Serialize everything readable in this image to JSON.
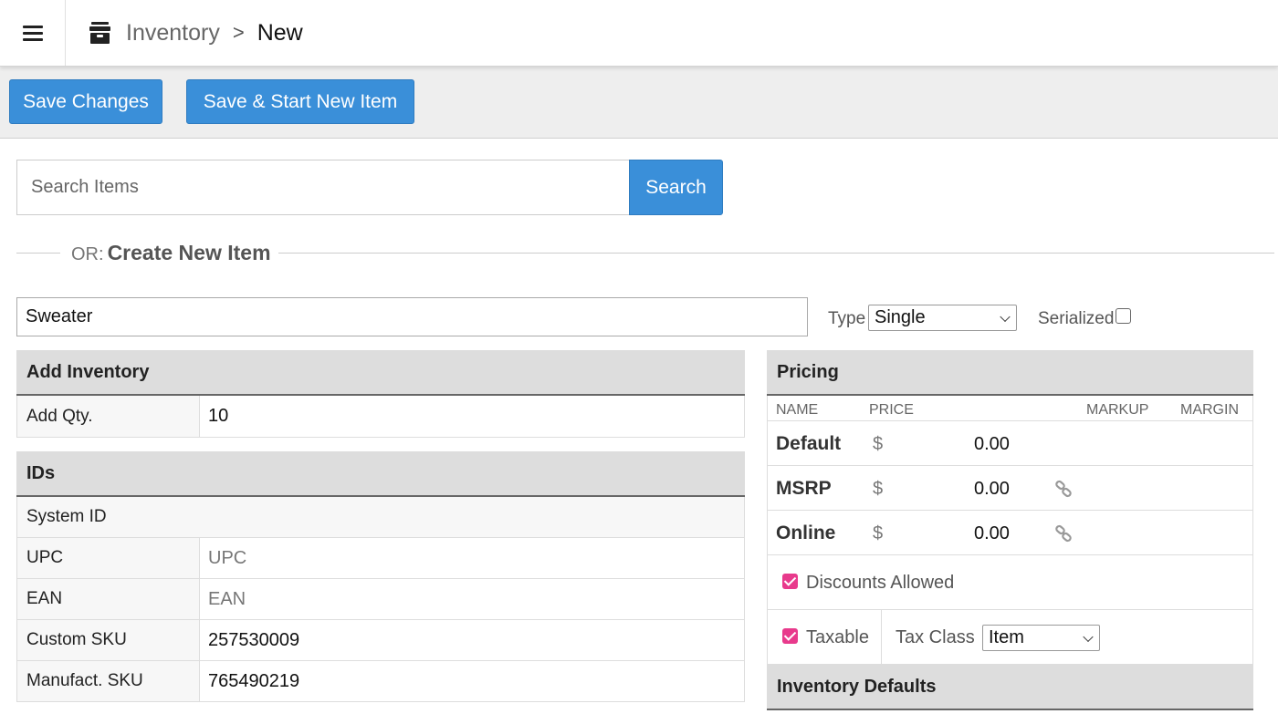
{
  "header": {
    "breadcrumb_parent": "Inventory",
    "breadcrumb_separator": ">",
    "breadcrumb_current": "New"
  },
  "toolbar": {
    "save_label": "Save Changes",
    "save_new_label": "Save & Start New Item"
  },
  "search": {
    "placeholder": "Search Items",
    "value": "",
    "button_label": "Search"
  },
  "create": {
    "or_label": "OR:",
    "title": "Create New Item",
    "item_name": "Sweater",
    "type_label": "Type",
    "type_value": "Single",
    "serialized_label": "Serialized",
    "serialized_checked": false
  },
  "add_inventory": {
    "title": "Add Inventory",
    "qty_label": "Add Qty.",
    "qty_value": "10"
  },
  "ids": {
    "title": "IDs",
    "system_id_label": "System ID",
    "upc_label": "UPC",
    "upc_placeholder": "UPC",
    "ean_label": "EAN",
    "ean_placeholder": "EAN",
    "custom_sku_label": "Custom SKU",
    "custom_sku_value": "257530009",
    "manufact_sku_label": "Manufact. SKU",
    "manufact_sku_value": "765490219"
  },
  "pricing": {
    "title": "Pricing",
    "columns": {
      "name": "NAME",
      "price": "PRICE",
      "markup": "MARKUP",
      "margin": "MARGIN"
    },
    "rows": [
      {
        "name": "Default",
        "currency": "$",
        "amount": "0.00",
        "linked": false
      },
      {
        "name": "MSRP",
        "currency": "$",
        "amount": "0.00",
        "linked": true
      },
      {
        "name": "Online",
        "currency": "$",
        "amount": "0.00",
        "linked": true
      }
    ],
    "discounts_label": "Discounts Allowed",
    "discounts_checked": true,
    "taxable_label": "Taxable",
    "taxable_checked": true,
    "tax_class_label": "Tax Class",
    "tax_class_value": "Item"
  },
  "inventory_defaults": {
    "title": "Inventory Defaults"
  },
  "icons": {
    "menu": "hamburger-menu-icon",
    "breadcrumb": "archive-box-icon",
    "price_link": "link-chain-icon"
  },
  "colors": {
    "primary_button": "#3a8fd9",
    "checkbox_accent": "#e83a8c",
    "section_header": "#dddddd",
    "toolbar_bg": "#eeeeee"
  }
}
